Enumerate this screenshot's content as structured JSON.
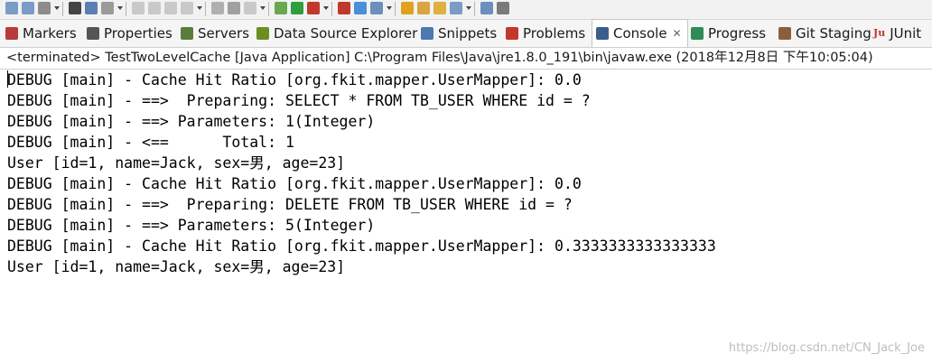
{
  "toolbar": {
    "icons": [
      "save-icon",
      "save-all-icon",
      "print-icon",
      "person-icon",
      "package-icon",
      "pin-icon",
      "run-icon",
      "stop-icon",
      "build-icon",
      "debug-icon",
      "search-icon",
      "refresh-icon",
      "tool-icon",
      "bug-icon",
      "play-icon",
      "new-icon",
      "new-dropdown-icon",
      "cloud-icon",
      "settings-icon",
      "folder-icon",
      "edit-icon",
      "open-icon",
      "link-icon",
      "back-icon",
      "up-icon"
    ]
  },
  "tabs": [
    {
      "label": "Markers",
      "icon": "markers-icon",
      "color": "#b83a3a"
    },
    {
      "label": "Properties",
      "icon": "properties-icon",
      "color": "#555555"
    },
    {
      "label": "Servers",
      "icon": "servers-icon",
      "color": "#5a7d3c"
    },
    {
      "label": "Data Source Explorer",
      "icon": "datasource-icon",
      "color": "#6b8e23"
    },
    {
      "label": "Snippets",
      "icon": "snippets-icon",
      "color": "#4a7ab0"
    },
    {
      "label": "Problems",
      "icon": "problems-icon",
      "color": "#c0392b"
    },
    {
      "label": "Console",
      "icon": "console-icon",
      "color": "#3b5f8a",
      "active": true,
      "close": "✕"
    },
    {
      "label": "Progress",
      "icon": "progress-icon",
      "color": "#2e8b57"
    },
    {
      "label": "Git Staging",
      "icon": "git-icon",
      "color": "#8b5e3c"
    },
    {
      "label": "JUnit",
      "icon": "junit-icon",
      "color": "#c0392b",
      "badge": "Ju"
    }
  ],
  "console": {
    "header": "<terminated> TestTwoLevelCache [Java Application] C:\\Program Files\\Java\\jre1.8.0_191\\bin\\javaw.exe (2018年12月8日 下午10:05:04)",
    "lines": [
      "DEBUG [main] - Cache Hit Ratio [org.fkit.mapper.UserMapper]: 0.0",
      "DEBUG [main] - ==>  Preparing: SELECT * FROM TB_USER WHERE id = ?",
      "DEBUG [main] - ==> Parameters: 1(Integer)",
      "DEBUG [main] - <==      Total: 1",
      "User [id=1, name=Jack, sex=男, age=23]",
      "DEBUG [main] - Cache Hit Ratio [org.fkit.mapper.UserMapper]: 0.0",
      "DEBUG [main] - ==>  Preparing: DELETE FROM TB_USER WHERE id = ?",
      "DEBUG [main] - ==> Parameters: 5(Integer)",
      "DEBUG [main] - Cache Hit Ratio [org.fkit.mapper.UserMapper]: 0.3333333333333333",
      "User [id=1, name=Jack, sex=男, age=23]"
    ]
  },
  "watermark": "https://blog.csdn.net/CN_Jack_Joe"
}
